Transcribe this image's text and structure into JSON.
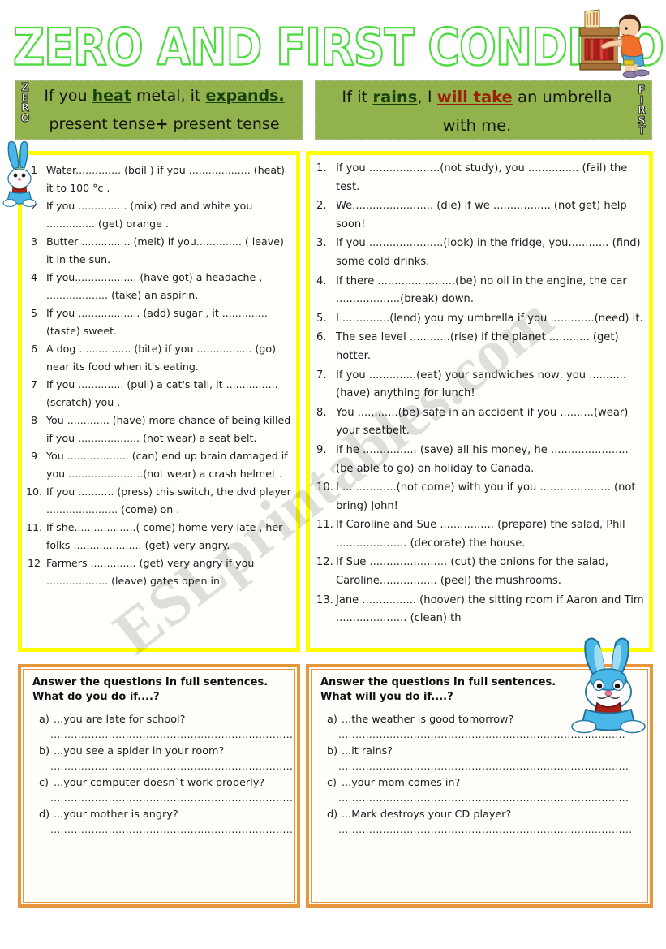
{
  "title": "ZERO AND FIRST CONDITIONAL",
  "watermark": "ESLprintables.com",
  "colors": {
    "title_outline": "#4ddb3f",
    "banner_green": "#91b24d",
    "exercise_border_yellow": "#ffff00",
    "answer_border_orange": "#e8963c",
    "keyword_green": "#17410d",
    "keyword_red": "#9a2008"
  },
  "banners": {
    "left": {
      "side_label": "ZERO",
      "line1_pre": "If you ",
      "line1_kw1": "heat",
      "line1_mid": " metal, it ",
      "line1_kw2": "expands.",
      "line2_a": "present tense",
      "line2_plus": "+",
      "line2_b": " present tense"
    },
    "right": {
      "side_label": "FIRST",
      "line1_pre": "If it ",
      "line1_kw1": "rains",
      "line1_mid": ", I ",
      "line1_kw2": "will take",
      "line1_post": " an umbrella",
      "line2": "with me."
    }
  },
  "exercises_zero": [
    {
      "num": "1",
      "text": "   Water.............. (boil ) if you ................... (heat) it to 100 °c ."
    },
    {
      "num": "2",
      "text": "If you ............... (mix) red and white you ............... (get) orange ."
    },
    {
      "num": "3",
      "text": "Butter ............... (melt) if you.............. ( leave) it in the sun."
    },
    {
      "num": "4",
      "text": "If you................... (have got)  a headache , ................... (take) an aspirin."
    },
    {
      "num": "5",
      "text": "If you ................... (add) sugar , it .............. (taste) sweet."
    },
    {
      "num": "6",
      "text": "A dog ................ (bite) if you ................. (go) near its food when it's eating."
    },
    {
      "num": "7",
      "text": "If you .............. (pull)    a cat's tail, it ................ (scratch)  you ."
    },
    {
      "num": "8",
      "text": "You ............. (have) more chance of being killed if you ................... (not wear) a seat belt."
    },
    {
      "num": "9",
      "text": "You ................... (can) end up brain damaged if you .......................(not wear) a crash helmet ."
    },
    {
      "num": "10.",
      "text": "If you ........... (press) this switch, the dvd player ...................... (come) on ."
    },
    {
      "num": "11.",
      "text": "If she...................( come) home very late , her folks ..................... (get) very angry."
    },
    {
      "num": "12",
      "text": "Farmers .............. (get) very angry if you ................... (leave) gates open in"
    }
  ],
  "exercises_first": [
    {
      "num": "1.",
      "text": "If you  .....................(not study), you ............... (fail) the test."
    },
    {
      "num": "2.",
      "text": "We........................  (die) if we ................. (not get) help soon!"
    },
    {
      "num": "3.",
      "text": "If you  ......................(look) in the fridge, you............   (find) some cold drinks."
    },
    {
      "num": "4.",
      "text": "If there  .......................(be) no oil in the engine, the car  ...................(break) down."
    },
    {
      "num": "5.",
      "text": "I ..............(lend) you my umbrella if you .............(need) it."
    },
    {
      "num": "6.",
      "text": "The sea level  ............(rise) if the planet ............ (get) hotter."
    },
    {
      "num": "7.",
      "text": "If you  ..............(eat) your sandwiches now, you ........... (have) anything for lunch!"
    },
    {
      "num": "8.",
      "text": "You  ............(be) safe in an accident if you ..........(wear) your seatbelt."
    },
    {
      "num": "9.",
      "text": "If he ................ (save) all his money, he ....................... (be able to go) on holiday to Canada."
    },
    {
      "num": "10.",
      "text": "I  ................(not come) with you if you ..................... (not bring) John!"
    },
    {
      "num": "11.",
      "text": "If Caroline and Sue ................ (prepare)  the salad, Phil  ..................... (decorate) the house."
    },
    {
      "num": "12.",
      "text": "If Sue ....................... (cut)  the onions for the salad, Caroline................. (peel)  the mushrooms."
    },
    {
      "num": "13.",
      "text": " Jane  ................ (hoover) the sitting room if Aaron and Tim ..................... (clean)  th"
    }
  ],
  "answers_left": {
    "head_line1": "Answer the questions In full sentences.",
    "head_line2": "What do you do if....?",
    "items": [
      {
        "letter": "a)",
        "q": "...you are late for school?",
        "rule": "............................................................................."
      },
      {
        "letter": "b)",
        "q": "...you see a spider in your room?",
        "rule": ".............................................................................."
      },
      {
        "letter": "c)",
        "q": "...your computer doesn`t work properly?",
        "rule": ".............................................................................."
      },
      {
        "letter": "d)",
        "q": "...your mother is angry?",
        "rule": "..........................................................................."
      }
    ]
  },
  "answers_right": {
    "head_line1": "Answer the questions In full sentences.",
    "head_line2": "What will you do if....?",
    "items": [
      {
        "letter": "a)",
        "q": "...the weather is good tomorrow?",
        "rule": "...................................................................................."
      },
      {
        "letter": "b)",
        "q": "...it rains?",
        "rule": "....................................................................................."
      },
      {
        "letter": "c)",
        "q": "...your mom comes in?",
        "rule": "....................................................................................."
      },
      {
        "letter": "d)",
        "q": "...Mark destroys your CD player?",
        "rule": "......................................................................................"
      }
    ]
  },
  "illustrations": {
    "boy": "boy-writing-at-bookshelf",
    "bunny_small": "blue-bunny-small",
    "bunny_big": "blue-bunny-large"
  }
}
